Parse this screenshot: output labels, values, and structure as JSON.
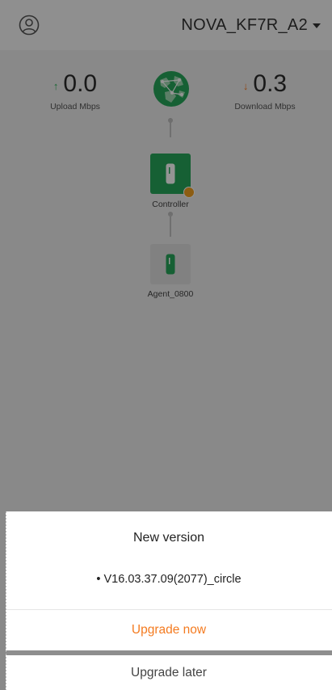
{
  "header": {
    "user_icon": "user-circle-icon",
    "network_name": "NOVA_KF7R_A2",
    "dropdown_icon": "caret-down-icon"
  },
  "stats": {
    "upload": {
      "arrow": "↑",
      "value": "0.0",
      "label": "Upload Mbps",
      "color": "#2fb45a"
    },
    "download": {
      "arrow": "↓",
      "value": "0.3",
      "label": "Download Mbps",
      "color": "#f47b20"
    }
  },
  "topology": {
    "internet_icon": "globe-icon",
    "controller": {
      "label": "Controller",
      "icon": "router-icon",
      "color": "#27a65a",
      "badge_color": "#f2a022"
    },
    "agent": {
      "label": "Agent_0800",
      "icon": "router-icon"
    }
  },
  "dialog": {
    "title": "New version",
    "version": "• V16.03.37.09(2077)_circle",
    "upgrade_now": "Upgrade now",
    "upgrade_later": "Upgrade later",
    "accent_color": "#f47b20"
  }
}
